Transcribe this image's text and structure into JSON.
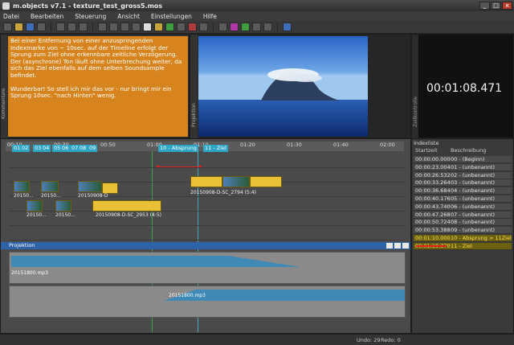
{
  "window": {
    "title": "m.objects v7.1 - texture_test_gross5.mos"
  },
  "menu": [
    "Datei",
    "Bearbeiten",
    "Steuerung",
    "Ansicht",
    "Einstellungen",
    "Hilfe"
  ],
  "panels": {
    "comments_label": "Kommentare",
    "projection_label": "Projektion",
    "timecode_label": "Zeitkontrolle"
  },
  "comment": {
    "para1": "Bei einer  Entfernung von einer anzuspringenden Indexmarke von ~ 10sec. auf der Timeline erfolgt der Sprung zum Ziel ohne erkennbare zeitliche Verzögerung.",
    "para2": "Der (asynchrone) Ton läuft ohne Unterbrechung weiter, da sich das Ziel ebenfalls auf dem selben Soundsample befindet.",
    "para3": "Wunderbar! So stell ich mir das vor - nur bringt mir ein Sprung 10sec. \"nach Hinten\" wenig."
  },
  "timecode": "00:01:08.471",
  "ruler": {
    "ticks": [
      "00:10",
      "00:20",
      "00:30",
      "00:40",
      "00:50",
      "01:00",
      "01:10",
      "01:20",
      "01:30",
      "01:40",
      "01:50",
      "02:00"
    ]
  },
  "markers": [
    "01",
    "02",
    "03",
    "04",
    "05",
    "06",
    "07",
    "08",
    "09",
    "10 - Absprung",
    "11 - Ziel"
  ],
  "clips": {
    "c1": "20150...",
    "c2": "20150...",
    "c3": "20150908-D",
    "c4": "20150...",
    "c5": "20150...",
    "c6": "20150908-D-SC_2953 (4:5)",
    "c7": "20150908-D-SC_2794 (5:4)",
    "c8": "20150908-D-SC_2937 (4:5)"
  },
  "projection_track": "Projektion",
  "audio": {
    "a1": "20151800.mp3",
    "a2": "20151800.mp3"
  },
  "index": {
    "title": "Indexliste",
    "col_time": "Startzeit",
    "col_desc": "Beschreibung",
    "rows": [
      {
        "time": "00:00:00.000",
        "desc": "00 - (Beginn)"
      },
      {
        "time": "00:00:23.004",
        "desc": "01 - (unbenannt)"
      },
      {
        "time": "00:00:26.532",
        "desc": "02 - (unbenannt)"
      },
      {
        "time": "00:00:33.264",
        "desc": "03 - (unbenannt)"
      },
      {
        "time": "00:00:36.684",
        "desc": "04 - (unbenannt)"
      },
      {
        "time": "00:00:40.176",
        "desc": "05 - (unbenannt)"
      },
      {
        "time": "00:00:43.740",
        "desc": "06 - (unbenannt)"
      },
      {
        "time": "00:00:47.268",
        "desc": "07 - (unbenannt)"
      },
      {
        "time": "00:00:50.724",
        "desc": "08 - (unbenannt)"
      },
      {
        "time": "00:00:53.388",
        "desc": "09 - (unbenannt)"
      },
      {
        "time": "00:01:10.000",
        "desc": "10 - Absprung > 11Ziel"
      },
      {
        "time": "00:01:19.370",
        "desc": "11 - Ziel"
      }
    ]
  },
  "status": {
    "undo": "Undo: 29",
    "redo": "Redo: 0"
  }
}
